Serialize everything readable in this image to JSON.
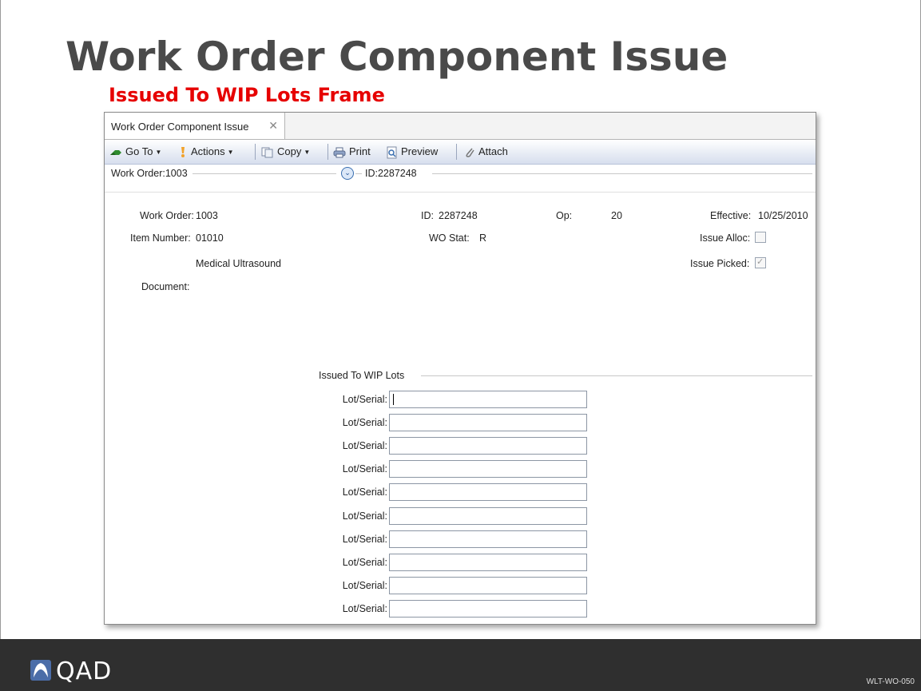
{
  "slide": {
    "title": "Work Order Component Issue",
    "subtitle": "Issued To WIP Lots Frame",
    "footer_code": "WLT-WO-050",
    "logo_text": "QAD"
  },
  "window": {
    "tab_label": "Work Order Component Issue",
    "close_glyph": "✕",
    "toolbar": {
      "goto": "Go To",
      "actions": "Actions",
      "copy": "Copy",
      "print": "Print",
      "preview": "Preview",
      "attach": "Attach"
    },
    "header": {
      "work_order_text": "Work Order:1003",
      "id_text": "ID:2287248"
    },
    "fields": {
      "work_order_label": "Work Order:",
      "work_order_value": "1003",
      "id_label": "ID:",
      "id_value": "2287248",
      "op_label": "Op:",
      "op_value": "20",
      "effective_label": "Effective:",
      "effective_value": "10/25/2010",
      "item_number_label": "Item Number:",
      "item_number_value": "01010",
      "wo_stat_label": "WO Stat:",
      "wo_stat_value": "R",
      "issue_alloc_label": "Issue Alloc:",
      "item_description": "Medical Ultrasound",
      "issue_picked_label": "Issue Picked:",
      "document_label": "Document:"
    },
    "checkboxes": {
      "issue_alloc_checked": false,
      "issue_picked_checked": true
    },
    "wip_frame": {
      "title": "Issued To WIP Lots",
      "rows": [
        {
          "label": "Lot/Serial:",
          "value": ""
        },
        {
          "label": "Lot/Serial:",
          "value": ""
        },
        {
          "label": "Lot/Serial:",
          "value": ""
        },
        {
          "label": "Lot/Serial:",
          "value": ""
        },
        {
          "label": "Lot/Serial:",
          "value": ""
        },
        {
          "label": "Lot/Serial:",
          "value": ""
        },
        {
          "label": "Lot/Serial:",
          "value": ""
        },
        {
          "label": "Lot/Serial:",
          "value": ""
        },
        {
          "label": "Lot/Serial:",
          "value": ""
        },
        {
          "label": "Lot/Serial:",
          "value": ""
        }
      ]
    }
  },
  "colors": {
    "title": "#4a4a4a",
    "subtitle": "#e60000",
    "footer_bg": "#2f2f2f",
    "logo_blue": "#4b6da8"
  },
  "icons": [
    "goto-icon",
    "actions-icon",
    "copy-icon",
    "print-icon",
    "preview-icon",
    "attach-icon",
    "expand-down-icon",
    "close-icon",
    "qad-logo-icon"
  ]
}
